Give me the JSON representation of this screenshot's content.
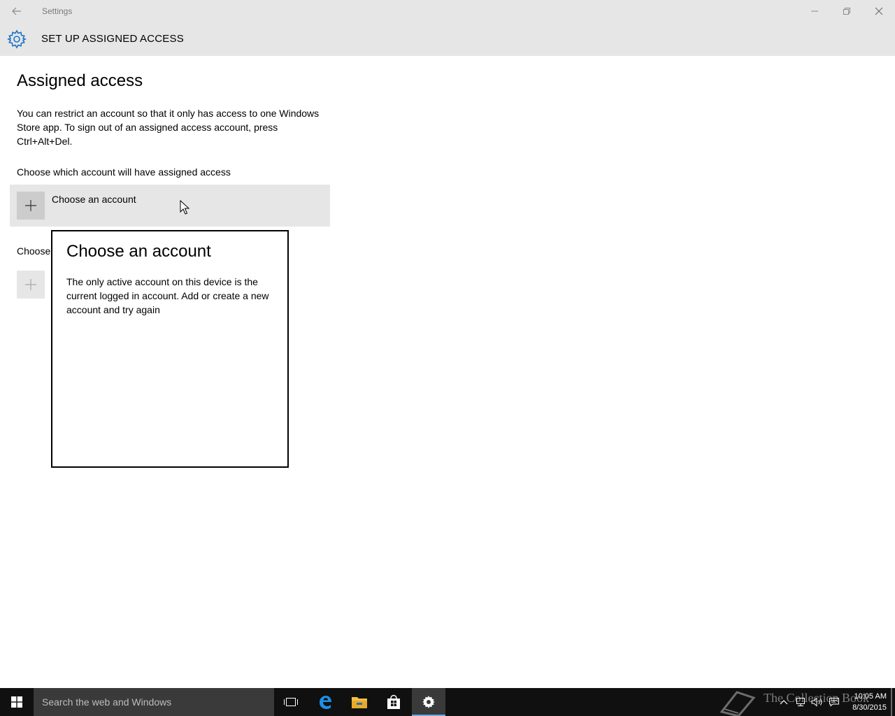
{
  "window": {
    "title": "Settings"
  },
  "header": {
    "title": "SET UP ASSIGNED ACCESS"
  },
  "main": {
    "page_title": "Assigned access",
    "description": "You can restrict an account so that it only has access to one Windows Store app. To sign out of an assigned access account, press Ctrl+Alt+Del.",
    "account_section_label": "Choose which account will have assigned access",
    "account_button_label": "Choose an account",
    "app_section_label": "Choose"
  },
  "flyout": {
    "title": "Choose an account",
    "message": "The only active account on this device is the current logged in account. Add or create a new account and try again"
  },
  "taskbar": {
    "search_placeholder": "Search the web and Windows",
    "watermark": "The Collection Book",
    "time": "10:05 AM",
    "date": "8/30/2015"
  },
  "icons": {
    "back": "back-arrow-icon",
    "minimize": "minimize-icon",
    "maximize": "restore-icon",
    "close": "close-icon",
    "settings": "gear-icon",
    "add": "plus-icon",
    "start": "windows-logo-icon",
    "task_view": "task-view-icon",
    "edge": "edge-icon",
    "explorer": "folder-icon",
    "store": "store-icon"
  },
  "colors": {
    "accent": "#1e74c9",
    "chrome": "#e6e6e6",
    "taskbar": "#101010"
  }
}
